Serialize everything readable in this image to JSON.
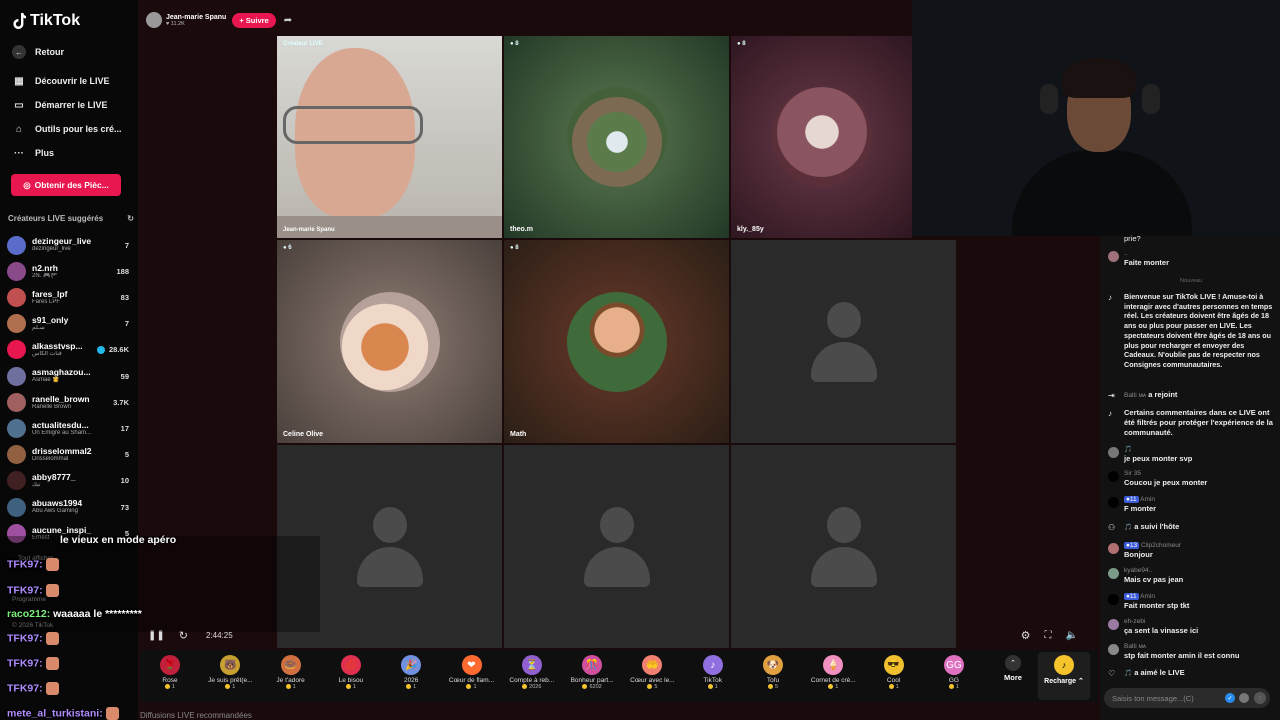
{
  "app": {
    "logo": "TikTok"
  },
  "nav": [
    {
      "label": "Retour",
      "icon": "arrow-left-icon"
    },
    {
      "label": "Découvrir le LIVE",
      "icon": "live-calendar-icon"
    },
    {
      "label": "Démarrer le LIVE",
      "icon": "camera-icon"
    },
    {
      "label": "Outils pour les cré...",
      "icon": "house-icon"
    },
    {
      "label": "Plus",
      "icon": "more-icon"
    }
  ],
  "coins_button": "Obtenir des Pièc...",
  "suggested": {
    "title": "Créateurs LIVE suggérés",
    "items": [
      {
        "name": "dezingeur_live",
        "sub": "dezingeur_live",
        "viewers": "7",
        "color": "#5a6cc9"
      },
      {
        "name": "n2.nrh",
        "sub": "2N. 🎮🏴",
        "viewers": "188",
        "color": "#8a4a8a"
      },
      {
        "name": "fares_lpf",
        "sub": "Fares LPF",
        "viewers": "83",
        "color": "#c05050"
      },
      {
        "name": "s91_only",
        "sub": "سـلم",
        "viewers": "7",
        "color": "#b07050"
      },
      {
        "name": "alkasstvsp...",
        "sub": "قنات الكاس",
        "viewers": "28.6K",
        "color": "#e8174f",
        "verified": true
      },
      {
        "name": "asmaghazou...",
        "sub": "Asmae 👸",
        "viewers": "59",
        "color": "#7070a0"
      },
      {
        "name": "ranelle_brown",
        "sub": "Ranelle Brown",
        "viewers": "3.7K",
        "color": "#a06060"
      },
      {
        "name": "actualitesdu...",
        "sub": "Un Émigré au Sham...",
        "viewers": "17",
        "color": "#507090"
      },
      {
        "name": "drisselommal2",
        "sub": "Drisselommal",
        "viewers": "5",
        "color": "#906040"
      },
      {
        "name": "abby8777_",
        "sub": "تيك",
        "viewers": "10",
        "color": "#402020"
      },
      {
        "name": "abuaws1994",
        "sub": "Abu Aws Gaming",
        "viewers": "73",
        "color": "#406080"
      },
      {
        "name": "aucune_inspi_",
        "sub": "Ernest",
        "viewers": "5",
        "color": "#a050a0"
      }
    ]
  },
  "host": {
    "name": "Jean-marie Spanu",
    "likes": "11.2K",
    "follow": "+ Suivre"
  },
  "tiles": [
    {
      "label": "Jean-marie Spanu",
      "badge": "Créateur LIVE"
    },
    {
      "label": "theo.m",
      "badge": "8"
    },
    {
      "label": "kly._85y",
      "badge": "8"
    },
    {
      "label": "Celine Olive",
      "badge": "6"
    },
    {
      "label": "Math",
      "badge": "8"
    },
    {
      "label": "",
      "badge": ""
    },
    {
      "label": "",
      "badge": ""
    },
    {
      "label": "",
      "badge": ""
    },
    {
      "label": "",
      "badge": ""
    }
  ],
  "player": {
    "time": "2:44:25"
  },
  "gifts": [
    {
      "name": "Rose",
      "price": "1",
      "color": "#c0203a",
      "glyph": "🌹"
    },
    {
      "name": "Je suis prêt(e...",
      "price": "1",
      "color": "#c8a030",
      "glyph": "🐻"
    },
    {
      "name": "Je t'adore",
      "price": "1",
      "color": "#d07040",
      "glyph": "🍩"
    },
    {
      "name": "Le bisou",
      "price": "1",
      "color": "#e03050",
      "glyph": "💋"
    },
    {
      "name": "2026",
      "price": "1",
      "color": "#7090e0",
      "glyph": "🎉"
    },
    {
      "name": "Cœur de flam...",
      "price": "1",
      "color": "#ff6a30",
      "glyph": "❤"
    },
    {
      "name": "Compte à reb...",
      "price": "2026",
      "color": "#9060d0",
      "glyph": "⏳"
    },
    {
      "name": "Bonheur part...",
      "price": "6202",
      "color": "#d050a0",
      "glyph": "🎊"
    },
    {
      "name": "Cœur avec le...",
      "price": "5",
      "color": "#f08070",
      "glyph": "🤲"
    },
    {
      "name": "TikTok",
      "price": "1",
      "color": "#9070e0",
      "glyph": "♪"
    },
    {
      "name": "Tofu",
      "price": "5",
      "color": "#e0a040",
      "glyph": "🐶"
    },
    {
      "name": "Cornet de crè...",
      "price": "1",
      "color": "#f090c0",
      "glyph": "🍦"
    },
    {
      "name": "Cool",
      "price": "1",
      "color": "#f0c030",
      "glyph": "😎"
    },
    {
      "name": "GG",
      "price": "1",
      "color": "#e070c0",
      "glyph": "GG"
    }
  ],
  "gift_more": "More",
  "recharge": "Recharge",
  "chat": {
    "messages": [
      {
        "user": "",
        "text": "prie?"
      },
      {
        "user": "..",
        "text": "Faite monter"
      },
      {
        "user": "Nouveau",
        "text": ""
      },
      {
        "user": "",
        "text": "Bienvenue sur TikTok LIVE ! Amuse-toi à interagir avec d'autres personnes en temps réel. Les créateurs doivent être âgés de 18 ans ou plus pour passer en LIVE. Les spectateurs doivent être âgés de 18 ans ou plus pour recharger et envoyer des Cadeaux. N'oublie pas de respecter nos Consignes communautaires."
      },
      {
        "user": "Balti ᴍᴀ",
        "text": "a rejoint"
      },
      {
        "user": "",
        "text": "Certains commentaires dans ce LIVE ont été filtrés pour protéger l'expérience de la communauté."
      },
      {
        "user": "",
        "text": "je peux monter svp"
      },
      {
        "user": "Sir 35",
        "text": "Coucou je peux monter"
      },
      {
        "user": "Amin",
        "text": "F monter"
      },
      {
        "user": "",
        "text": "a suivi l'hôte"
      },
      {
        "user": "Clip2chomeur",
        "text": "Bonjour"
      },
      {
        "user": "kyabe94..",
        "text": "Mais cv pas jean"
      },
      {
        "user": "Amin",
        "text": "Fait monter stp tkt"
      },
      {
        "user": "eh-zebi",
        "text": "ça sent la vinasse ici"
      },
      {
        "user": "Balti ᴍᴀ",
        "text": "stp fait monter amin il est connu"
      },
      {
        "user": "",
        "text": "a aimé le LIVE"
      }
    ],
    "input_placeholder": "Saisis ton message...(C)"
  },
  "overlay": {
    "lines": [
      {
        "user": "",
        "text": "le vieux en mode apéro"
      },
      {
        "user": "TFK97:",
        "text": ""
      },
      {
        "user": "TFK97:",
        "text": ""
      },
      {
        "user": "raco212:",
        "text": "waaaaa le *********"
      },
      {
        "user": "TFK97:",
        "text": ""
      },
      {
        "user": "TFK97:",
        "text": ""
      },
      {
        "user": "TFK97:",
        "text": ""
      },
      {
        "user": "mete_al_turkistani:",
        "text": ""
      }
    ],
    "ghost_programme": "Programme",
    "ghost_copyright": "© 2026 TikTok",
    "recommended": "Diffusions LIVE recommandées"
  }
}
